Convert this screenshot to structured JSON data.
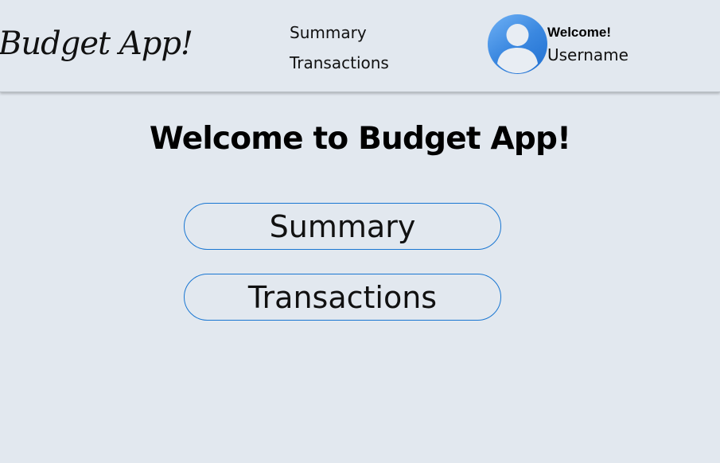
{
  "header": {
    "brand": "Budget App!",
    "nav": {
      "summary_label": "Summary",
      "transactions_label": "Transactions"
    },
    "user": {
      "greeting": "Welcome!",
      "username": "Username",
      "avatar_icon": "user-avatar-icon",
      "avatar_color": "#3b88e0"
    }
  },
  "main": {
    "title": "Welcome to Budget App!",
    "summary_button_label": "Summary",
    "transactions_button_label": "Transactions"
  },
  "colors": {
    "background": "#e2e8ef",
    "button_border": "#1976d2"
  }
}
